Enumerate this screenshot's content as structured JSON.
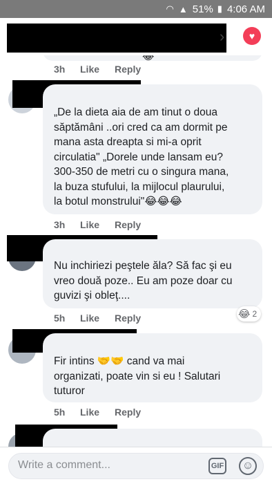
{
  "status_bar": {
    "battery": "51%",
    "time": "4:06 AM"
  },
  "header": {
    "chevron": "›",
    "like_icon": "heart-icon",
    "accent": "#f33e58"
  },
  "comments": [
    {
      "text_lines": [],
      "time": "3h",
      "like_label": "Like",
      "reply_label": "Reply"
    },
    {
      "text_lines": [
        "„De la dieta aia de am tinut o doua",
        "săptămâni ..ori cred ca am dormit pe",
        "mana asta  dreapta si mi-a oprit",
        "circulatia\" „Dorele unde lansam eu?",
        "300-350 de metri cu o singura mana,",
        "la  buza stufului, la mijlocul plaurului,",
        "la botul monstrului\"😂😂😂"
      ],
      "time": "3h",
      "like_label": "Like",
      "reply_label": "Reply"
    },
    {
      "text_lines": [
        "Nu inchiriezi peştele ăla? Să fac şi eu",
        "vreo două poze..  Eu am poze doar cu",
        "guvizi şi obleţ...."
      ],
      "time": "5h",
      "like_label": "Like",
      "reply_label": "Reply",
      "reaction_emoji": "😂",
      "reaction_count": "2"
    },
    {
      "text_lines": [
        "Fir intins 🤝🤝 cand va mai",
        "organizati, poate vin si eu ! Salutari",
        "tuturor"
      ],
      "time": "5h",
      "like_label": "Like",
      "reply_label": "Reply"
    }
  ],
  "composer": {
    "placeholder": "Write a comment...",
    "gif_label": "GIF",
    "emoji_icon": "☺"
  },
  "colors": {
    "bubble": "#f0f2f5",
    "meta_text": "#65676b",
    "status_bar": "#7a7a7a"
  }
}
